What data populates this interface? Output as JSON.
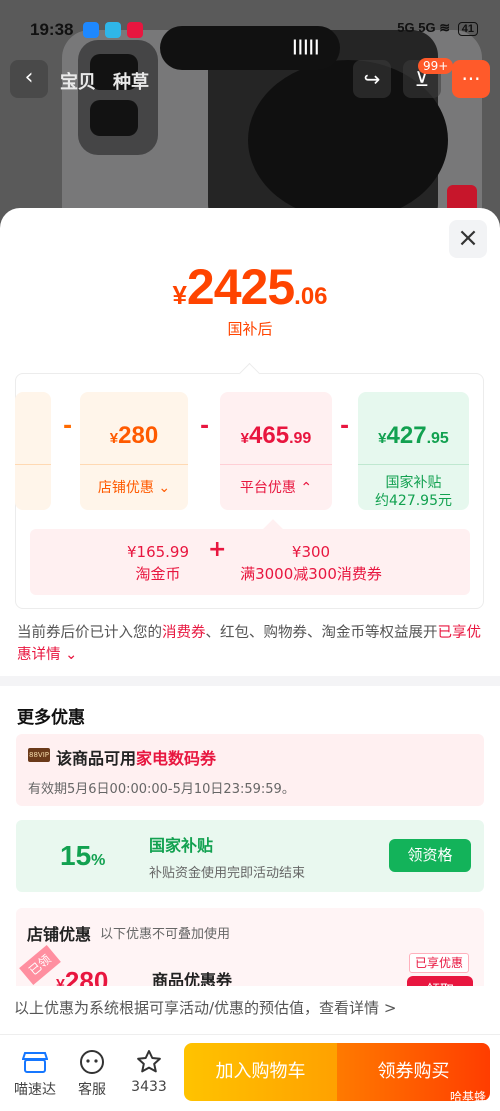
{
  "status": {
    "time": "19:38",
    "signal": "5G 5G",
    "battery": "41"
  },
  "nav": {
    "tabs": [
      "宝贝",
      "种草"
    ],
    "cart_badge": "99+"
  },
  "sheet": {
    "price": {
      "currency": "¥",
      "integer": "2425",
      "decimal": ".06",
      "label": "国补后"
    },
    "breakdown": {
      "shop": {
        "currency": "¥",
        "integer": "280",
        "decimal": "",
        "label": "店铺优惠"
      },
      "platform": {
        "currency": "¥",
        "integer": "465",
        "decimal": ".99",
        "label": "平台优惠"
      },
      "subsidy": {
        "currency": "¥",
        "integer": "427",
        "decimal": ".95",
        "label_line1": "国家补贴",
        "label_line2": "约427.95元"
      },
      "platform_detail": [
        {
          "amount": "¥165.99",
          "name": "淘金币"
        },
        {
          "amount": "¥300",
          "name": "满3000减300消费券"
        }
      ],
      "minus_sign": "-",
      "plus_sign": "+"
    },
    "notice": {
      "prefix": "当前券后价已计入您的",
      "highlight1": "消费券",
      "middle": "、红包、购物券、淘金币等权益展开",
      "link": "已享优惠详情"
    },
    "more_title": "更多优惠",
    "coupon_home": {
      "tag": "88VIP",
      "title_prefix": "该商品可用",
      "title_highlight": "家电数码券",
      "validity": "有效期5月6日00:00:00-5月10日23:59:59。"
    },
    "subsidy_promo": {
      "percent": "15",
      "percent_sign": "%",
      "title": "国家补贴",
      "desc": "补贴资金使用完即活动结束",
      "button": "领资格"
    },
    "shop_promo": {
      "title": "店铺优惠",
      "note": "以下优惠不可叠加使用",
      "stamp": "已领",
      "amount_currency": "¥",
      "amount": "280",
      "name": "商品优惠券",
      "tag": "已享优惠",
      "button": "领取"
    },
    "footnote": "以上优惠为系统根据可享活动/优惠的预估值，查看详情 >"
  },
  "bottom": {
    "items": [
      {
        "label": "喵速达",
        "icon": "store-icon"
      },
      {
        "label": "客服",
        "icon": "service-icon"
      },
      {
        "label": "3433",
        "icon": "star-icon"
      }
    ],
    "cart_button": "加入购物车",
    "buy_button": "领券购买",
    "watermark": "哈基蜂"
  },
  "colors": {
    "price": "#ff4400",
    "pink": "#e8163f",
    "green": "#12a150",
    "orange": "#ff5a00"
  }
}
